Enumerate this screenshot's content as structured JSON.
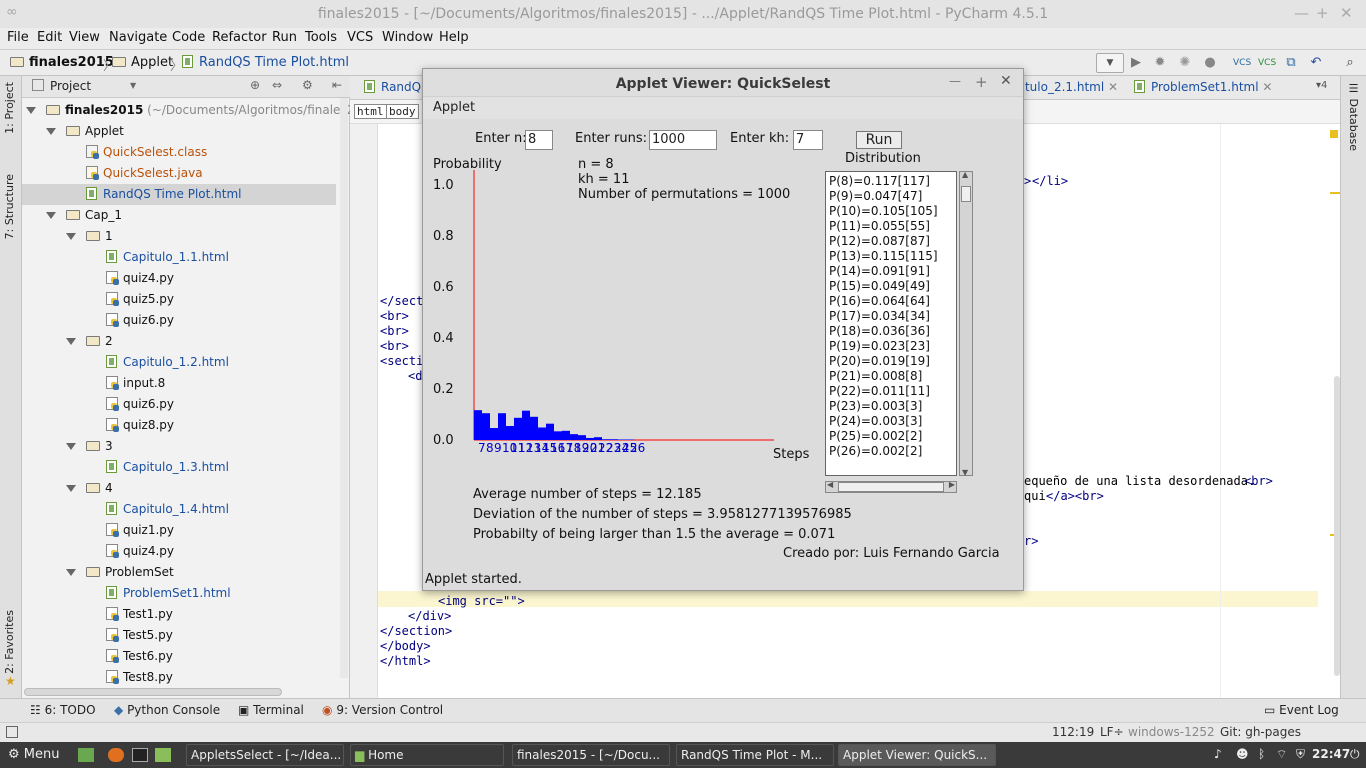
{
  "ide": {
    "window_title": "finales2015 - [~/Documents/Algoritmos/finales2015] - .../Applet/RandQS Time Plot.html - PyCharm 4.5.1",
    "menu": [
      "File",
      "Edit",
      "View",
      "Navigate",
      "Code",
      "Refactor",
      "Run",
      "Tools",
      "VCS",
      "Window",
      "Help"
    ],
    "breadcrumb": [
      "finales2015",
      "Applet",
      "RandQS Time Plot.html"
    ],
    "left_tabs": [
      "1: Project",
      "7: Structure",
      "2: Favorites"
    ],
    "right_tab": "Database",
    "project_panel": {
      "header": "Project",
      "tree": [
        {
          "label": "finales2015",
          "path": "(~/Documents/Algoritmos/finales20",
          "type": "root"
        },
        {
          "label": "Applet",
          "type": "folder"
        },
        {
          "label": "QuickSelest.class",
          "type": "class"
        },
        {
          "label": "QuickSelest.java",
          "type": "java"
        },
        {
          "label": "RandQS Time Plot.html",
          "type": "html"
        },
        {
          "label": "Cap_1",
          "type": "folder"
        },
        {
          "label": "1",
          "type": "folder"
        },
        {
          "label": "Capitulo_1.1.html",
          "type": "html"
        },
        {
          "label": "quiz4.py",
          "type": "py"
        },
        {
          "label": "quiz5.py",
          "type": "py"
        },
        {
          "label": "quiz6.py",
          "type": "py"
        },
        {
          "label": "2",
          "type": "folder"
        },
        {
          "label": "Capitulo_1.2.html",
          "type": "html"
        },
        {
          "label": "input.8",
          "type": "text"
        },
        {
          "label": "quiz6.py",
          "type": "py"
        },
        {
          "label": "quiz8.py",
          "type": "py"
        },
        {
          "label": "3",
          "type": "folder"
        },
        {
          "label": "Capitulo_1.3.html",
          "type": "html"
        },
        {
          "label": "4",
          "type": "folder"
        },
        {
          "label": "Capitulo_1.4.html",
          "type": "html"
        },
        {
          "label": "quiz1.py",
          "type": "py"
        },
        {
          "label": "quiz4.py",
          "type": "py"
        },
        {
          "label": "ProblemSet",
          "type": "folder"
        },
        {
          "label": "ProblemSet1.html",
          "type": "html"
        },
        {
          "label": "Test1.py",
          "type": "py"
        },
        {
          "label": "Test5.py",
          "type": "py"
        },
        {
          "label": "Test6.py",
          "type": "py"
        },
        {
          "label": "Test8.py",
          "type": "py"
        }
      ]
    },
    "editor_tabs": [
      "RandQS",
      "pitulo_2.1.html",
      "ProblemSet1.html"
    ],
    "tab_count": "4",
    "breadcrumb_tags": [
      "html",
      "body"
    ],
    "code_lines": [
      "</sect",
      "<br>",
      "<br>",
      "<br>",
      "<secti",
      "<d"
    ],
    "code_right": [
      ">",
      "</li>",
      "equeño de una lista desordenada.",
      "<br>",
      "qui",
      "</a><br>",
      "r>"
    ],
    "code_bottom": [
      "<img src=\"\">",
      "</div>",
      "</section>",
      "</body>",
      "</html>"
    ],
    "bottom_tools": [
      "6: TODO",
      "Python Console",
      "Terminal",
      "9: Version Control",
      "Event Log"
    ],
    "status": {
      "position": "112:19",
      "line_sep": "LF÷",
      "encoding": "windows-1252",
      "git": "Git: gh-pages"
    }
  },
  "taskbar": {
    "menu_label": "Menu",
    "items": [
      "AppletsSelect - [~/Idea...",
      "Home",
      "finales2015 - [~/Docu...",
      "RandQS Time Plot - M...",
      "Applet Viewer: QuickS..."
    ],
    "clock": "22:47"
  },
  "applet": {
    "title": "Applet Viewer: QuickSelest",
    "menu": "Applet",
    "enter_n_label": "Enter n:",
    "enter_n_value": "8",
    "enter_runs_label": "Enter runs:",
    "enter_runs_value": "1000",
    "enter_kh_label": "Enter kh:",
    "enter_kh_value": "7",
    "run_button": "Run",
    "info_n": "n = 8",
    "info_kh": "kh = 11",
    "info_perm": "Number of permutations = 1000",
    "distribution_label": "Distribution",
    "distribution": [
      "P(8)=0.117[117]",
      "P(9)=0.047[47]",
      "P(10)=0.105[105]",
      "P(11)=0.055[55]",
      "P(12)=0.087[87]",
      "P(13)=0.115[115]",
      "P(14)=0.091[91]",
      "P(15)=0.049[49]",
      "P(16)=0.064[64]",
      "P(17)=0.034[34]",
      "P(18)=0.036[36]",
      "P(19)=0.023[23]",
      "P(20)=0.019[19]",
      "P(21)=0.008[8]",
      "P(22)=0.011[11]",
      "P(23)=0.003[3]",
      "P(24)=0.003[3]",
      "P(25)=0.002[2]",
      "P(26)=0.002[2]"
    ],
    "avg": "Average number of steps =  12.185",
    "dev": "Deviation  of the number of steps =  3.9581277139576985",
    "prob": "Probabilty of being larger than 1.5 the average =  0.071",
    "credit": "Creado por: Luis Fernando Garcia",
    "status": "Applet started."
  },
  "chart_data": {
    "type": "bar",
    "ylabel": "Probability",
    "xlabel": "Steps",
    "ylim": [
      0,
      1.0
    ],
    "yticks": [
      "1.0",
      "0.8",
      "0.6",
      "0.4",
      "0.2",
      "0.0"
    ],
    "categories": [
      "7",
      "8",
      "9",
      "10",
      "11",
      "12",
      "13",
      "14",
      "15",
      "16",
      "17",
      "18",
      "19",
      "20",
      "21",
      "22",
      "23",
      "24",
      "25",
      "26"
    ],
    "values": [
      0.117,
      0.105,
      0.047,
      0.105,
      0.055,
      0.087,
      0.115,
      0.091,
      0.049,
      0.064,
      0.034,
      0.036,
      0.023,
      0.019,
      0.008,
      0.011,
      0.003,
      0.003,
      0.002,
      0.002
    ],
    "bar_color": "#0000ff",
    "axis_color": "#ff0000",
    "tick_color": "#0000cc"
  }
}
